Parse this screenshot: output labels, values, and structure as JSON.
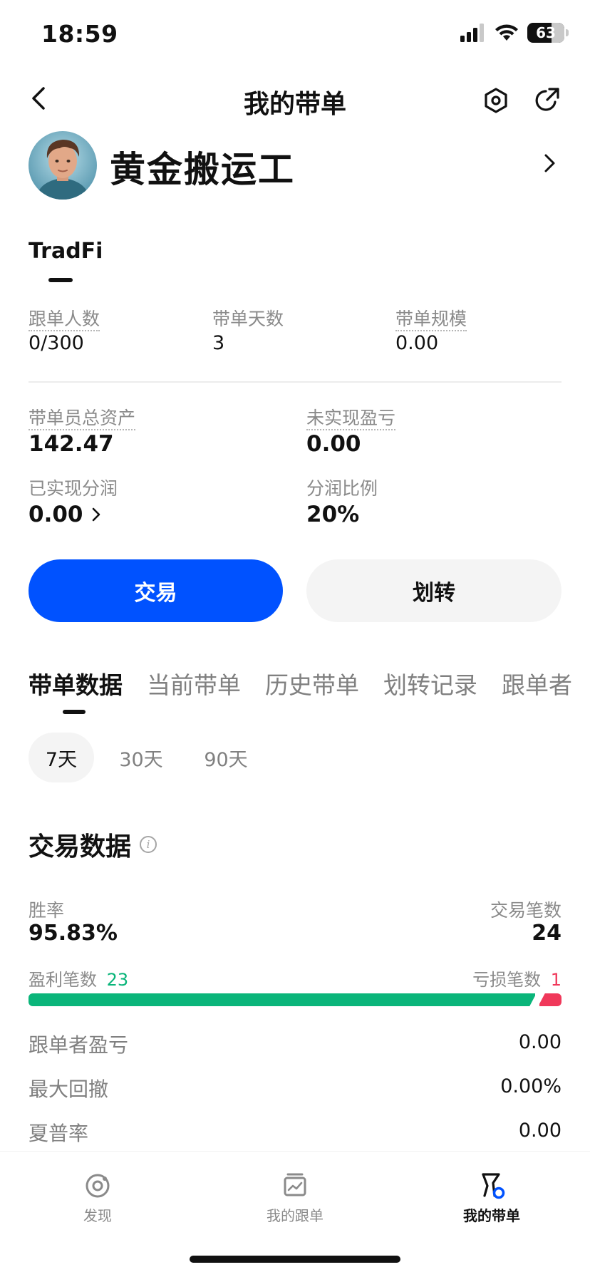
{
  "status_bar": {
    "time": "18:59",
    "battery": "63"
  },
  "nav": {
    "title": "我的带单"
  },
  "profile": {
    "name": "黄金搬运工"
  },
  "account_tab": {
    "label": "TradFi"
  },
  "stats_top": [
    {
      "label": "跟单人数",
      "value": "0/300"
    },
    {
      "label": "带单天数",
      "value": "3"
    },
    {
      "label": "带单规模",
      "value": "0.00"
    }
  ],
  "stats_mid": {
    "total_assets_label": "带单员总资产",
    "total_assets_value": "142.47",
    "unrealized_label": "未实现盈亏",
    "unrealized_value": "0.00",
    "realized_share_label": "已实现分润",
    "realized_share_value": "0.00",
    "share_ratio_label": "分润比例",
    "share_ratio_value": "20%"
  },
  "actions": {
    "trade_label": "交易",
    "transfer_label": "划转"
  },
  "tabs": [
    "带单数据",
    "当前带单",
    "历史带单",
    "划转记录",
    "跟单者"
  ],
  "periods": [
    "7天",
    "30天",
    "90天"
  ],
  "trade_data": {
    "title": "交易数据",
    "win_rate_label": "胜率",
    "win_rate_value": "95.83%",
    "trade_count_label": "交易笔数",
    "trade_count_value": "24",
    "profit_count_label": "盈利笔数",
    "profit_count_value": "23",
    "loss_count_label": "亏损笔数",
    "loss_count_value": "1",
    "win_fraction": 0.9583,
    "rows": [
      {
        "label": "跟单者盈亏",
        "value": "0.00"
      },
      {
        "label": "最大回撤",
        "value": "0.00%"
      },
      {
        "label": "夏普率",
        "value": "0.00"
      }
    ]
  },
  "colors": {
    "primary": "#0052ff",
    "profit": "#0ab57a",
    "loss": "#f0385a"
  },
  "tabbar": {
    "items": [
      {
        "label": "发现",
        "icon": "discover-icon"
      },
      {
        "label": "我的跟单",
        "icon": "copy-trades-icon"
      },
      {
        "label": "我的带单",
        "icon": "lead-trades-icon"
      }
    ]
  }
}
